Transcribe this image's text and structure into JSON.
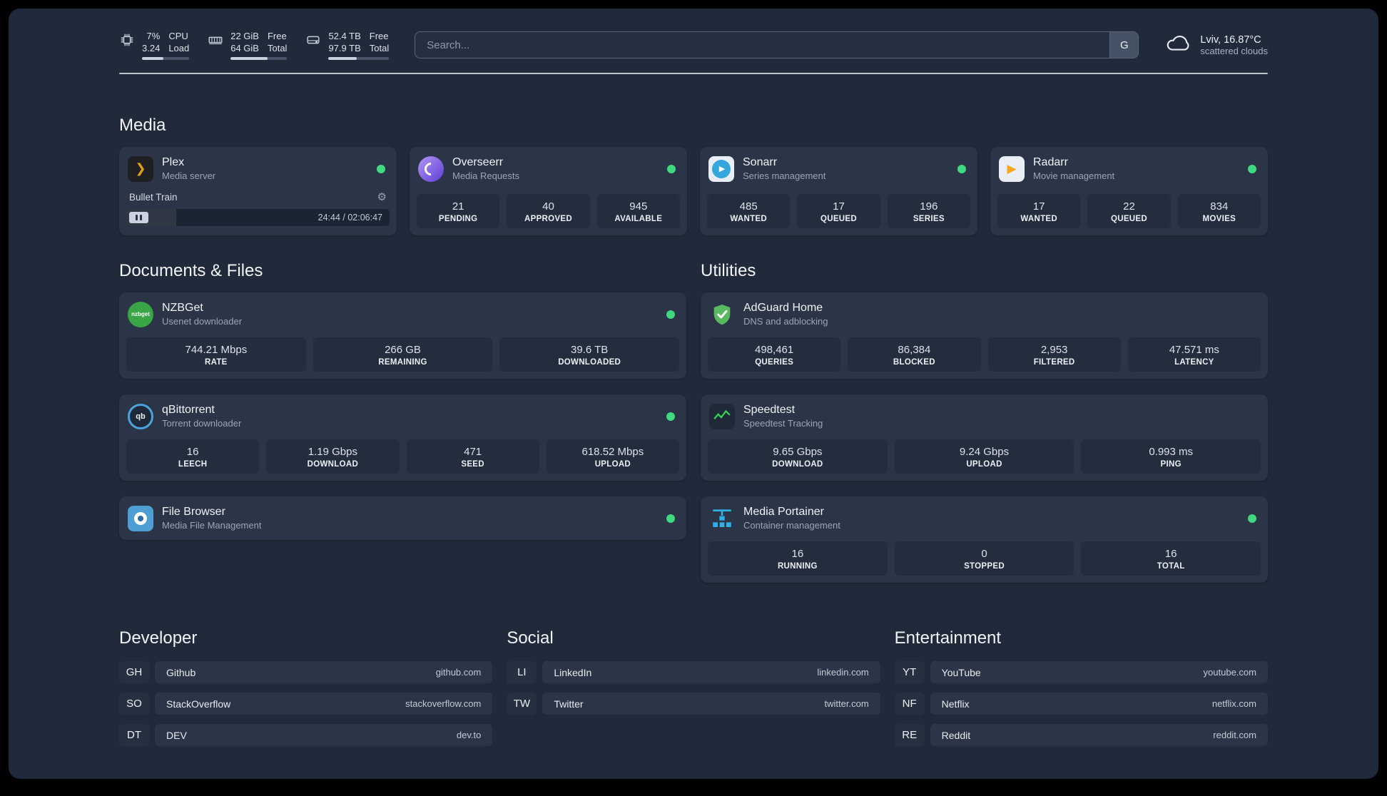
{
  "theme": {
    "background": "#202a3a",
    "card": "#2b3547",
    "tile": "#232d3e",
    "status_online": "#41d97f",
    "accent_plex": "#e5a00d",
    "accent_adguard": "#59b95e",
    "accent_speedtest": "#34d65c",
    "accent_portainer": "#2fb1e8"
  },
  "icons": {
    "plex_chevron": "❯",
    "play": "▶",
    "gear": "⚙"
  },
  "topbar": {
    "cpu": {
      "value_top": "7%",
      "value_bottom": "3.24",
      "label_top": "CPU",
      "label_bottom": "Load",
      "progress_pct": 45
    },
    "memory": {
      "value_top": "22 GiB",
      "value_bottom": "64 GiB",
      "label_top": "Free",
      "label_bottom": "Total",
      "progress_pct": 65
    },
    "disk": {
      "value_top": "52.4 TB",
      "value_bottom": "97.9 TB",
      "label_top": "Free",
      "label_bottom": "Total",
      "progress_pct": 47
    },
    "search": {
      "placeholder": "Search...",
      "provider_label": "G"
    },
    "weather": {
      "location_temp": "Lviv, 16.87°C",
      "condition": "scattered clouds"
    }
  },
  "media": {
    "heading": "Media",
    "cards": [
      {
        "title": "Plex",
        "subtitle": "Media server",
        "online": true,
        "now_playing": {
          "title": "Bullet Train",
          "time": "24:44 / 02:06:47",
          "progress_pct": 19
        }
      },
      {
        "title": "Overseerr",
        "subtitle": "Media Requests",
        "online": true,
        "stats": [
          {
            "value": "21",
            "label": "PENDING"
          },
          {
            "value": "40",
            "label": "APPROVED"
          },
          {
            "value": "945",
            "label": "AVAILABLE"
          }
        ]
      },
      {
        "title": "Sonarr",
        "subtitle": "Series management",
        "online": true,
        "stats": [
          {
            "value": "485",
            "label": "WANTED"
          },
          {
            "value": "17",
            "label": "QUEUED"
          },
          {
            "value": "196",
            "label": "SERIES"
          }
        ]
      },
      {
        "title": "Radarr",
        "subtitle": "Movie management",
        "online": true,
        "stats": [
          {
            "value": "17",
            "label": "WANTED"
          },
          {
            "value": "22",
            "label": "QUEUED"
          },
          {
            "value": "834",
            "label": "MOVIES"
          }
        ]
      }
    ]
  },
  "documents": {
    "heading": "Documents & Files",
    "cards": [
      {
        "title": "NZBGet",
        "subtitle": "Usenet downloader",
        "online": true,
        "icon_text": "nzbget",
        "stats": [
          {
            "value": "744.21 Mbps",
            "label": "RATE"
          },
          {
            "value": "266 GB",
            "label": "REMAINING"
          },
          {
            "value": "39.6 TB",
            "label": "DOWNLOADED"
          }
        ]
      },
      {
        "title": "qBittorrent",
        "subtitle": "Torrent downloader",
        "online": true,
        "icon_text": "qb",
        "stats": [
          {
            "value": "16",
            "label": "LEECH"
          },
          {
            "value": "1.19 Gbps",
            "label": "DOWNLOAD"
          },
          {
            "value": "471",
            "label": "SEED"
          },
          {
            "value": "618.52 Mbps",
            "label": "UPLOAD"
          }
        ]
      },
      {
        "title": "File Browser",
        "subtitle": "Media File Management",
        "online": true
      }
    ]
  },
  "utilities": {
    "heading": "Utilities",
    "cards": [
      {
        "title": "AdGuard Home",
        "subtitle": "DNS and adblocking",
        "online": false,
        "stats": [
          {
            "value": "498,461",
            "label": "QUERIES"
          },
          {
            "value": "86,384",
            "label": "BLOCKED"
          },
          {
            "value": "2,953",
            "label": "FILTERED"
          },
          {
            "value": "47.571 ms",
            "label": "LATENCY"
          }
        ]
      },
      {
        "title": "Speedtest",
        "subtitle": "Speedtest Tracking",
        "online": false,
        "stats": [
          {
            "value": "9.65 Gbps",
            "label": "DOWNLOAD"
          },
          {
            "value": "9.24 Gbps",
            "label": "UPLOAD"
          },
          {
            "value": "0.993 ms",
            "label": "PING"
          }
        ]
      },
      {
        "title": "Media Portainer",
        "subtitle": "Container management",
        "online": true,
        "stats": [
          {
            "value": "16",
            "label": "RUNNING"
          },
          {
            "value": "0",
            "label": "STOPPED"
          },
          {
            "value": "16",
            "label": "TOTAL"
          }
        ]
      }
    ]
  },
  "bookmarks": {
    "developer": {
      "heading": "Developer",
      "items": [
        {
          "abbr": "GH",
          "name": "Github",
          "url": "github.com"
        },
        {
          "abbr": "SO",
          "name": "StackOverflow",
          "url": "stackoverflow.com"
        },
        {
          "abbr": "DT",
          "name": "DEV",
          "url": "dev.to"
        }
      ]
    },
    "social": {
      "heading": "Social",
      "items": [
        {
          "abbr": "LI",
          "name": "LinkedIn",
          "url": "linkedin.com"
        },
        {
          "abbr": "TW",
          "name": "Twitter",
          "url": "twitter.com"
        }
      ]
    },
    "entertainment": {
      "heading": "Entertainment",
      "items": [
        {
          "abbr": "YT",
          "name": "YouTube",
          "url": "youtube.com"
        },
        {
          "abbr": "NF",
          "name": "Netflix",
          "url": "netflix.com"
        },
        {
          "abbr": "RE",
          "name": "Reddit",
          "url": "reddit.com"
        }
      ]
    }
  }
}
